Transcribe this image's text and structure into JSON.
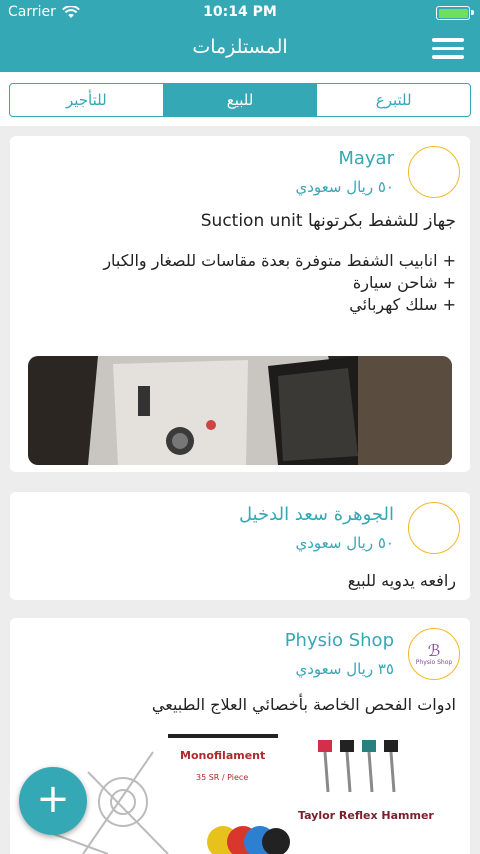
{
  "status_bar": {
    "carrier": "Carrier",
    "time": "10:14 PM"
  },
  "header": {
    "title": "المستلزمات"
  },
  "segments": [
    {
      "label": "للتبرع"
    },
    {
      "label": "للبيع",
      "active": true
    },
    {
      "label": "للتأجير"
    }
  ],
  "posts": [
    {
      "name": "Mayar",
      "price": "٥٠ ريال سعودي",
      "description": [
        "جهاز للشفط بكرتونها Suction unit",
        "",
        "+ انابيب الشفط متوفرة بعدة مقاسات للصغار والكبار",
        "+ شاحن سيارة",
        "+ سلك كهربائي"
      ]
    },
    {
      "name": "الجوهرة سعد الدخيل",
      "price": "٥٠ ريال سعودي",
      "description": [
        "رافعه يدويه للبيع"
      ]
    },
    {
      "name": "Physio Shop",
      "price": "٣٥ ريال سعودي",
      "description": [
        "ادوات الفحص الخاصة بأخصائي العلاج الطبيعي"
      ],
      "avatar_text": "Physio Shop",
      "image_labels": {
        "mono": "Monofilament",
        "mono_price": "35 SR / Piece",
        "hammer": "Taylor Reflex Hammer"
      }
    }
  ],
  "fab": {
    "icon": "plus-icon",
    "label": "+"
  },
  "colors": {
    "accent": "#35a8b5",
    "avatar_border": "#f2b928"
  }
}
